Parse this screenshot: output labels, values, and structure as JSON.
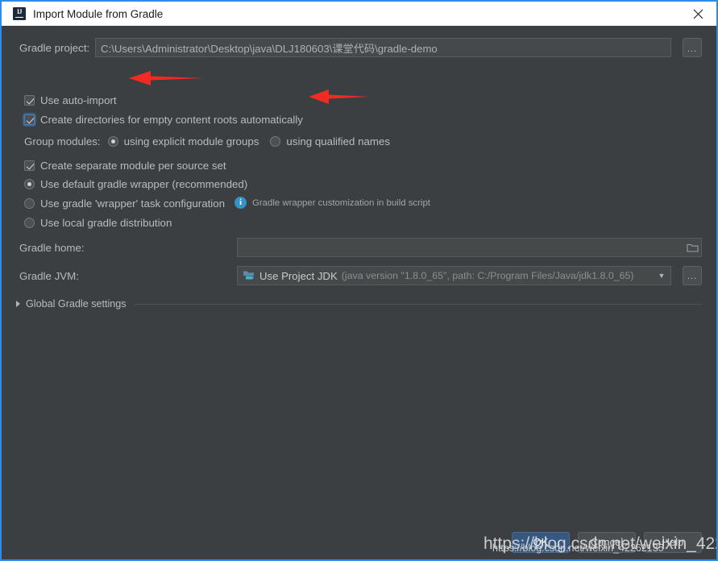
{
  "window": {
    "title": "Import Module from Gradle",
    "icon": "intellij-idea-icon",
    "close_label": "✕",
    "border_color": "#2d8ceb",
    "titlebar_bg": "#ffffff",
    "body_bg": "#3c3f41"
  },
  "project_row": {
    "label": "Gradle project:",
    "value": "C:\\Users\\Administrator\\Desktop\\java\\DLJ180603\\课堂代码\\gradle-demo",
    "placeholder": "",
    "browse_label": "..."
  },
  "checkboxes": [
    {
      "label": "Use auto-import",
      "checked": true,
      "focused": false
    },
    {
      "label": "Create directories for empty content roots automatically",
      "checked": true,
      "focused": true
    },
    {
      "label": "Create separate module per source set",
      "checked": true,
      "focused": false
    }
  ],
  "group_modules": {
    "label": "Group modules:",
    "options": [
      {
        "label": "using explicit module groups",
        "selected": true
      },
      {
        "label": "using qualified names",
        "selected": false
      }
    ]
  },
  "distribution_options": [
    {
      "label": "Use default gradle wrapper (recommended)",
      "selected": true
    },
    {
      "label": "Use gradle 'wrapper' task configuration",
      "selected": false
    },
    {
      "label": "Use local gradle distribution",
      "selected": false
    }
  ],
  "wrapper_hint": {
    "icon": "info-icon",
    "text": "Gradle wrapper customization in build script",
    "icon_color": "#3592c4"
  },
  "gradle_home": {
    "label": "Gradle home:",
    "value": "",
    "placeholder": "",
    "browse_icon": "folder-icon"
  },
  "gradle_jvm": {
    "label": "Gradle JVM:",
    "icon": "jdk-icon",
    "selected_main": "Use Project JDK",
    "selected_detail": "(java version \"1.8.0_65\", path: C:/Program Files/Java/jdk1.8.0_65)",
    "arrow": "▼",
    "browse_label": "..."
  },
  "global_settings": {
    "label": "Global Gradle settings",
    "expanded": false,
    "arrow": "▶"
  },
  "buttons": {
    "ok": "OK",
    "cancel": "Cancel",
    "help": "Help",
    "primary_color": "#365880"
  },
  "annotations": {
    "arrow_color": "#f12b24",
    "arrows": [
      {
        "name": "arrow-use-auto-import",
        "points_to": "Use auto-import"
      },
      {
        "name": "arrow-create-directories",
        "points_to": "Create directories for empty content roots automatically"
      }
    ]
  },
  "watermark": {
    "text": "https://blog.csdn.net/weixin_42262135"
  }
}
